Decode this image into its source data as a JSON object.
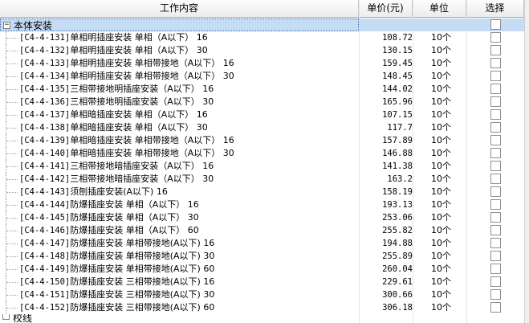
{
  "columns": {
    "work": "工作内容",
    "price": "单价(元)",
    "unit": "单位",
    "select": "选择"
  },
  "group": {
    "label": "本体安装",
    "expander": "−"
  },
  "items": [
    {
      "code": "[C4-4-131]",
      "name": "单相明插座安装 单相（A以下） 16",
      "price": "108.72",
      "unit": "10个"
    },
    {
      "code": "[C4-4-132]",
      "name": "单相明插座安装 单相（A以下） 30",
      "price": "130.15",
      "unit": "10个"
    },
    {
      "code": "[C4-4-133]",
      "name": "单相明插座安装 单相带接地（A以下） 16",
      "price": "159.45",
      "unit": "10个"
    },
    {
      "code": "[C4-4-134]",
      "name": "单相明插座安装 单相带接地（A以下） 30",
      "price": "148.45",
      "unit": "10个"
    },
    {
      "code": "[C4-4-135]",
      "name": "三相带接地明插座安装（A以下） 16",
      "price": "144.02",
      "unit": "10个"
    },
    {
      "code": "[C4-4-136]",
      "name": "三相带接地明插座安装（A以下） 30",
      "price": "165.96",
      "unit": "10个"
    },
    {
      "code": "[C4-4-137]",
      "name": "单相暗插座安装 单相（A以下） 16",
      "price": "107.15",
      "unit": "10个"
    },
    {
      "code": "[C4-4-138]",
      "name": "单相暗插座安装 单相（A以下） 30",
      "price": "117.7",
      "unit": "10个"
    },
    {
      "code": "[C4-4-139]",
      "name": "单相暗插座安装 单相带接地（A以下） 16",
      "price": "157.89",
      "unit": "10个"
    },
    {
      "code": "[C4-4-140]",
      "name": "单相暗插座安装 单相带接地（A以下） 30",
      "price": "146.88",
      "unit": "10个"
    },
    {
      "code": "[C4-4-141]",
      "name": "三相带接地暗插座安装（A以下） 16",
      "price": "141.38",
      "unit": "10个"
    },
    {
      "code": "[C4-4-142]",
      "name": "三相带接地暗插座安装（A以下） 30",
      "price": "163.2",
      "unit": "10个"
    },
    {
      "code": "[C4-4-143]",
      "name": "须刨插座安装(A以下) 16",
      "price": "158.19",
      "unit": "10个"
    },
    {
      "code": "[C4-4-144]",
      "name": "防爆插座安装 单相（A以下） 16",
      "price": "193.13",
      "unit": "10个"
    },
    {
      "code": "[C4-4-145]",
      "name": "防爆插座安装 单相（A以下） 30",
      "price": "253.06",
      "unit": "10个"
    },
    {
      "code": "[C4-4-146]",
      "name": "防爆插座安装 单相（A以下） 60",
      "price": "255.82",
      "unit": "10个"
    },
    {
      "code": "[C4-4-147]",
      "name": "防爆插座安装 单相带接地(A以下) 16",
      "price": "194.88",
      "unit": "10个"
    },
    {
      "code": "[C4-4-148]",
      "name": "防爆插座安装 单相带接地(A以下) 30",
      "price": "255.89",
      "unit": "10个"
    },
    {
      "code": "[C4-4-149]",
      "name": "防爆插座安装 单相带接地(A以下) 60",
      "price": "260.04",
      "unit": "10个"
    },
    {
      "code": "[C4-4-150]",
      "name": "防爆插座安装 三相带接地(A以下) 16",
      "price": "229.61",
      "unit": "10个"
    },
    {
      "code": "[C4-4-151]",
      "name": "防爆插座安装 三相带接地(A以下) 30",
      "price": "300.66",
      "unit": "10个"
    },
    {
      "code": "[C4-4-152]",
      "name": "防爆插座安装 三相带接地(A以下) 60",
      "price": "306.18",
      "unit": "10个"
    }
  ],
  "next_group": {
    "label": "校线"
  }
}
